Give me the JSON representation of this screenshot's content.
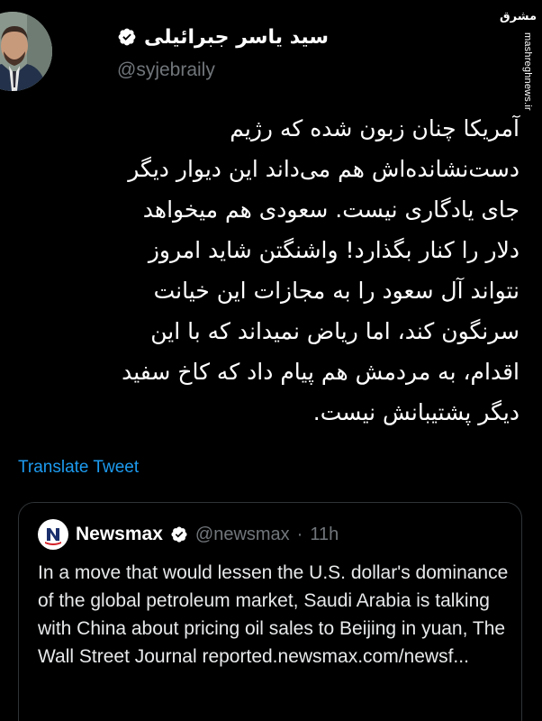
{
  "watermark": {
    "logo": "مشرق",
    "url": "mashreghnews.ir"
  },
  "tweet": {
    "author_name": "سید یاسر جبرائیلی",
    "handle": "@syjebraily",
    "lines": [
      "آمریکا چنان زبون شده که رژیم",
      "دست‌نشانده‌اش هم می‌داند این دیوار دیگر",
      "جای یادگاری نیست. سعودی هم میخواهد",
      "دلار را کنار بگذارد! واشنگتن شاید امروز",
      "نتواند آل سعود را به مجازات این خیانت",
      "سرنگون کند، اما ریاض نمیداند که با این",
      "اقدام، به مردمش هم پیام داد که کاخ سفید",
      "دیگر پشتیبانش نیست."
    ],
    "translate_label": "Translate Tweet"
  },
  "quote": {
    "name": "Newsmax",
    "handle": "@newsmax",
    "separator": "·",
    "time": "11h",
    "text": "In a move that would lessen the U.S. dollar's dominance of the global petroleum market, Saudi Arabia is talking with China about pricing oil sales to Beijing in yuan, The Wall Street Journal reported.newsmax.com/newsf..."
  },
  "colors": {
    "background": "#000000",
    "text": "#ffffff",
    "muted": "#71767b",
    "link": "#1d9bf0",
    "border": "#2f3336",
    "verified_badge": "#ffffff"
  }
}
